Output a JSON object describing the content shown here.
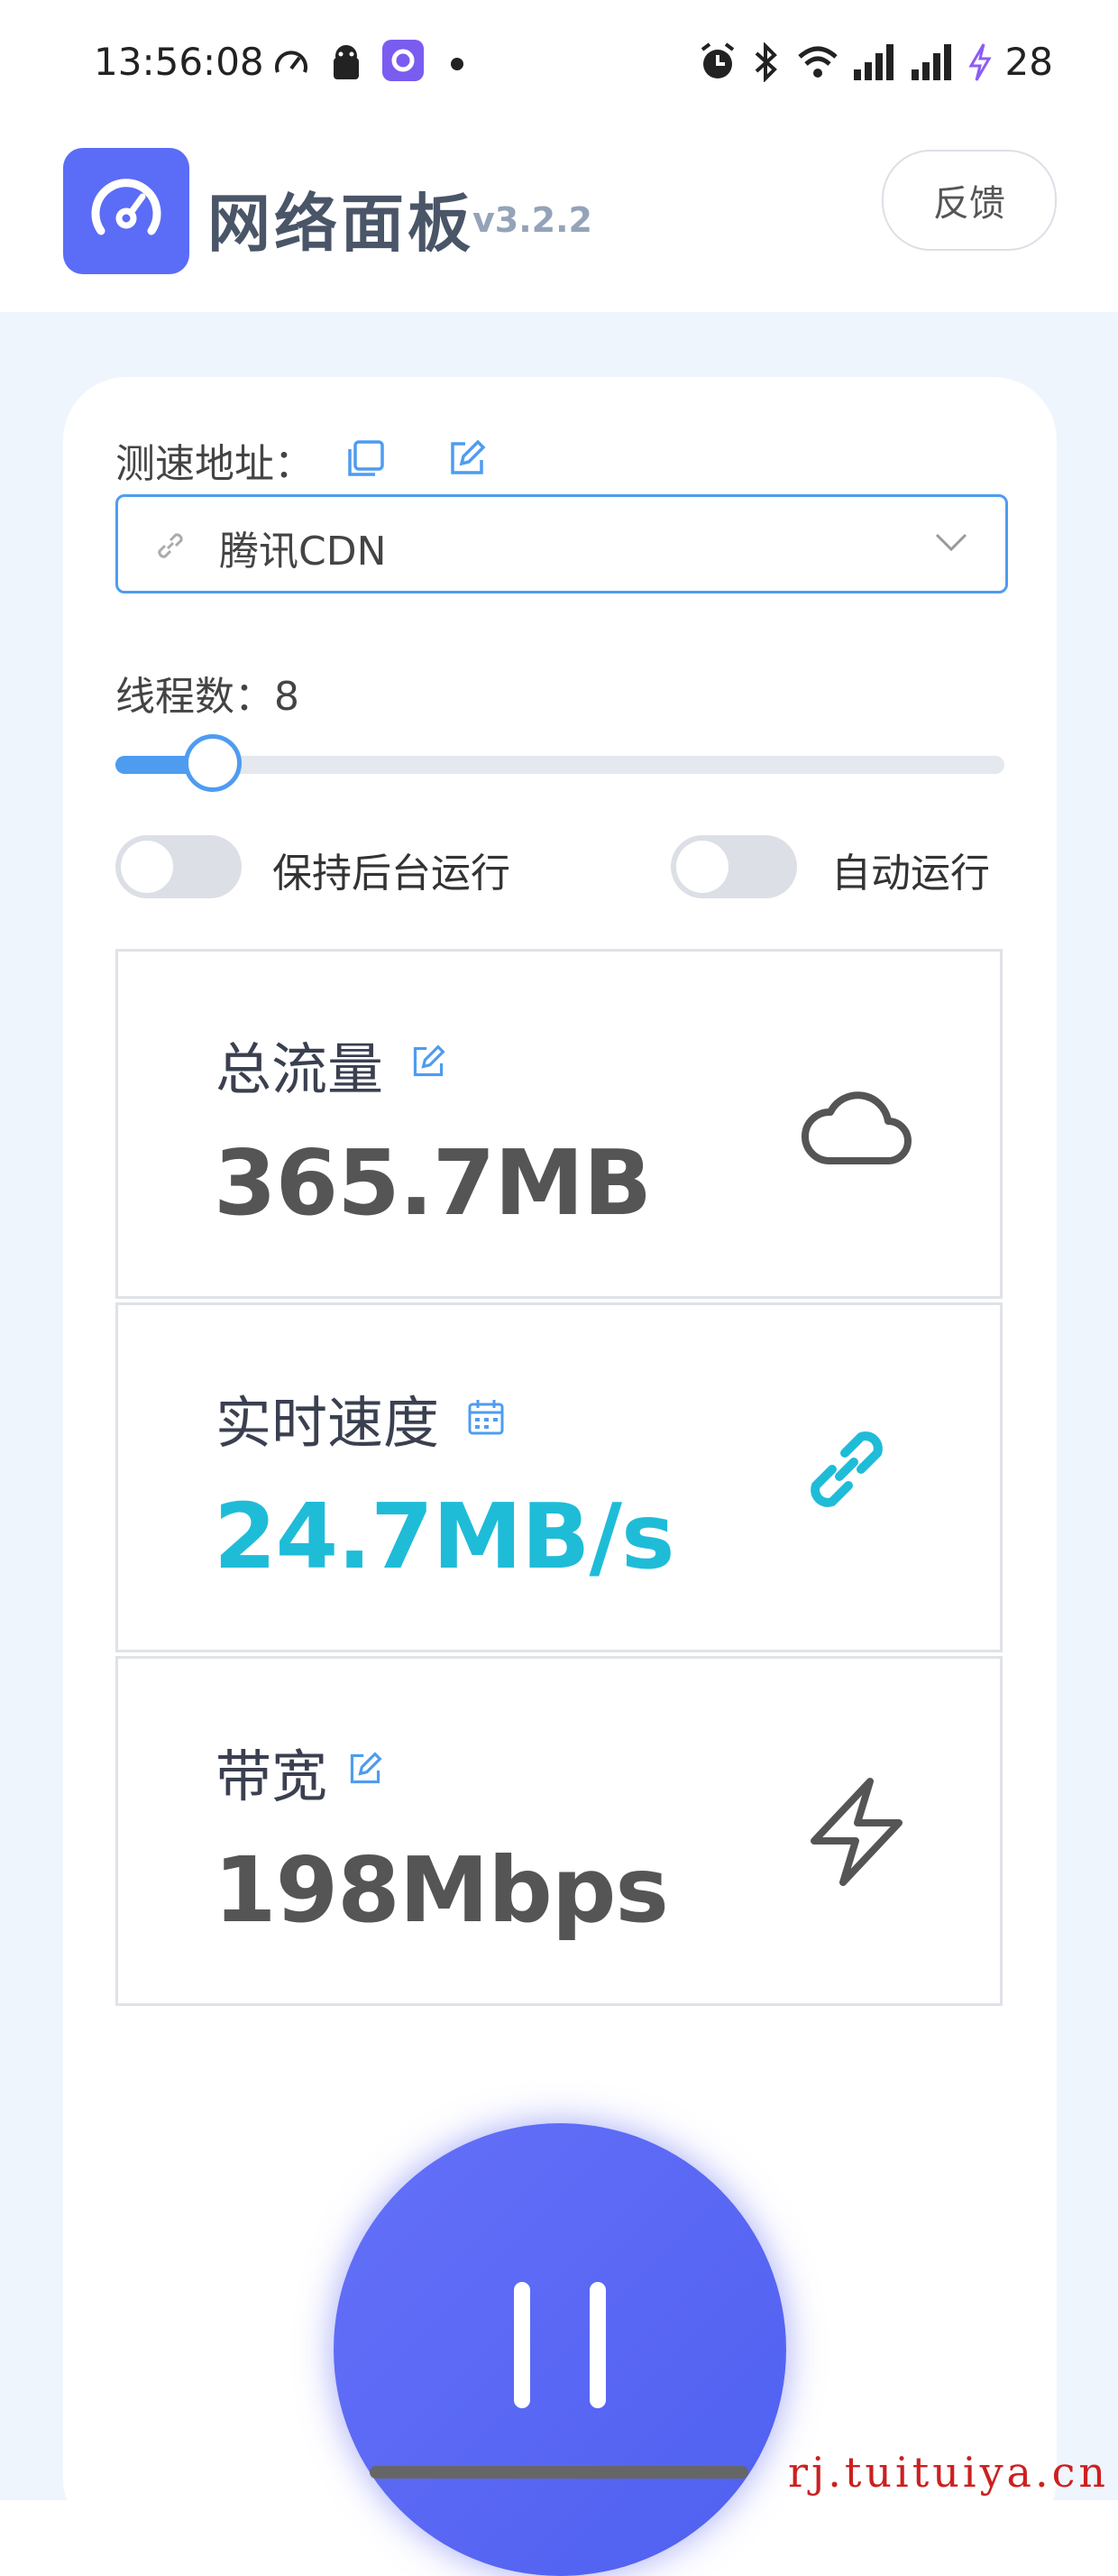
{
  "status_bar": {
    "time": "13:56:08",
    "battery": "28",
    "left_icons": [
      "speedometer-icon",
      "android-icon",
      "app-icon",
      "dot-icon"
    ],
    "right_icons": [
      "alarm-icon",
      "bluetooth-icon",
      "wifi-icon",
      "signal-icon",
      "signal-icon",
      "charging-icon"
    ]
  },
  "header": {
    "title": "网络面板",
    "version": "v3.2.2",
    "feedback_label": "反馈"
  },
  "url": {
    "label": "测速地址：",
    "selected": "腾讯CDN"
  },
  "threads": {
    "label": "线程数：",
    "value": "8",
    "fraction": 0.11
  },
  "toggles": [
    {
      "label": "保持后台运行",
      "on": false
    },
    {
      "label": "自动运行",
      "on": false
    }
  ],
  "stats": [
    {
      "title": "总流量",
      "value": "365.7MB",
      "small_icon": "edit-icon",
      "icon": "cloud-icon",
      "color": "#555555"
    },
    {
      "title": "实时速度",
      "value": "24.7MB/s",
      "small_icon": "calendar-icon",
      "icon": "link-icon",
      "color": "#1fbcd8"
    },
    {
      "title": "带宽",
      "value": "198Mbps",
      "small_icon": "edit-icon",
      "icon": "lightning-icon",
      "color": "#555555"
    }
  ],
  "action": {
    "icon": "pause-icon",
    "color": "#5b6cf6"
  },
  "watermark": "rj.tuituiya.cn",
  "colors": {
    "accent": "#4e9cf0",
    "brand": "#5b6cf6",
    "speed": "#1fbcd8"
  }
}
